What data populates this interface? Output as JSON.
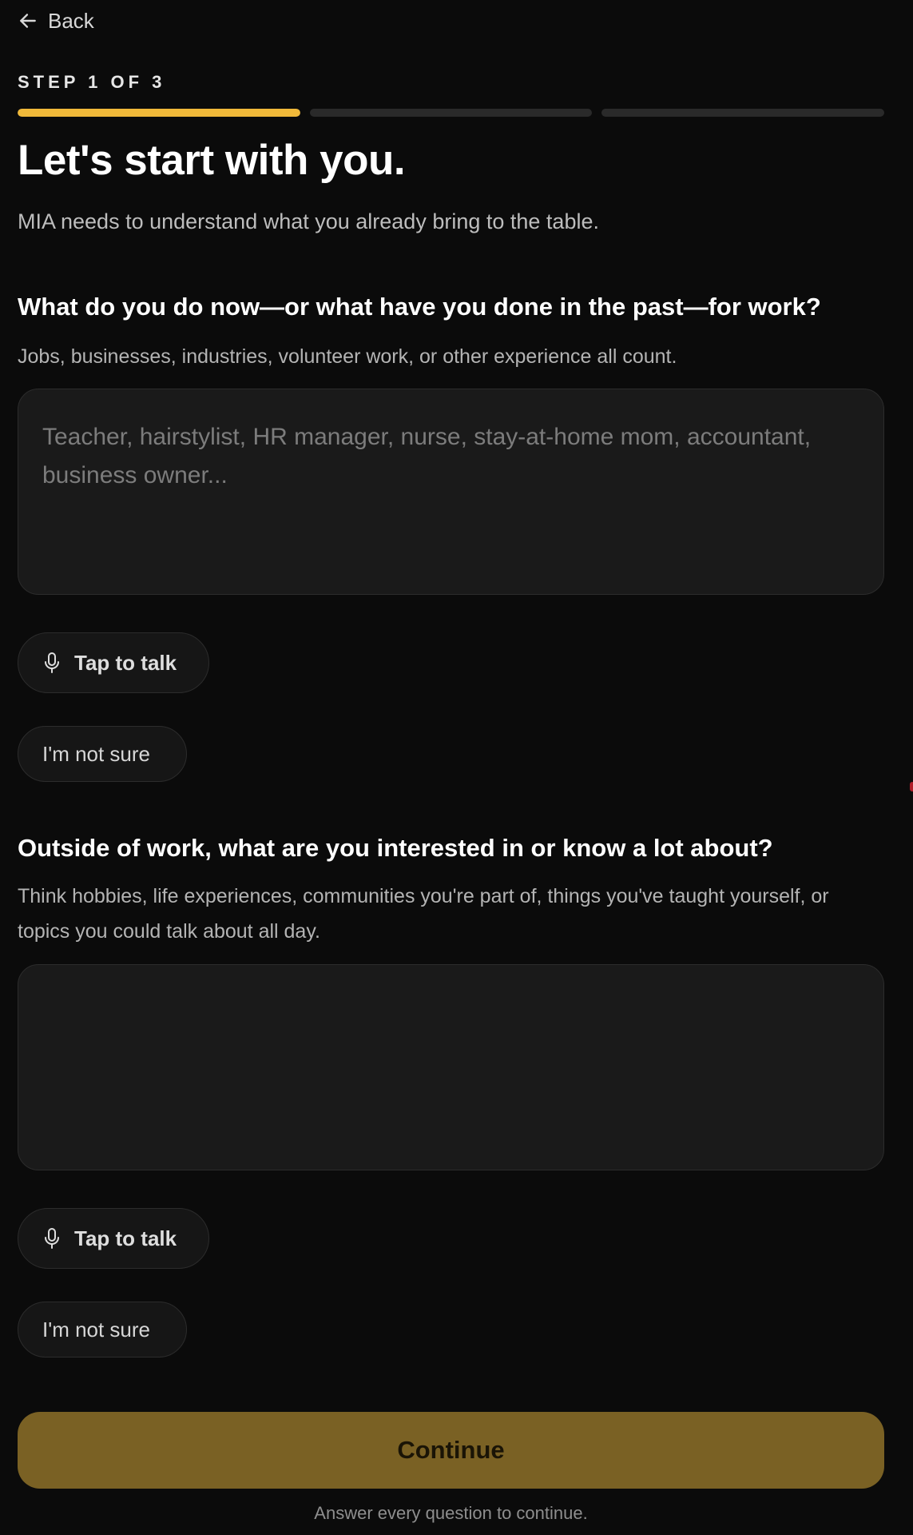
{
  "nav": {
    "back_label": "Back"
  },
  "progress": {
    "label": "STEP 1 OF 3",
    "current_step": 1,
    "total_steps": 3,
    "active_color": "#f0b93a"
  },
  "header": {
    "title": "Let's start with you.",
    "subtitle": "MIA needs to understand what you already bring to the table."
  },
  "questions": [
    {
      "title": "What do you do now—or what have you done in the past—for work?",
      "hint": "Jobs, businesses, industries, volunteer work, or other experience all count.",
      "value": "",
      "placeholder": "Teacher, hairstylist, HR manager, nurse, stay-at-home mom, accountant, business owner...",
      "talk_label": "Tap to talk",
      "unsure_label": "I'm not sure"
    },
    {
      "title": "Outside of work, what are you interested in or know a lot about?",
      "hint": "Think hobbies, life experiences, communities you're part of, things you've taught yourself, or topics you could talk about all day.",
      "value": "",
      "placeholder": "",
      "talk_label": "Tap to talk",
      "unsure_label": "I'm not sure"
    }
  ],
  "footer": {
    "continue_label": "Continue",
    "continue_color": "#7a6124",
    "note": "Answer every question to continue."
  },
  "icons": {
    "back": "arrow-left-icon",
    "talk": "microphone-icon"
  }
}
